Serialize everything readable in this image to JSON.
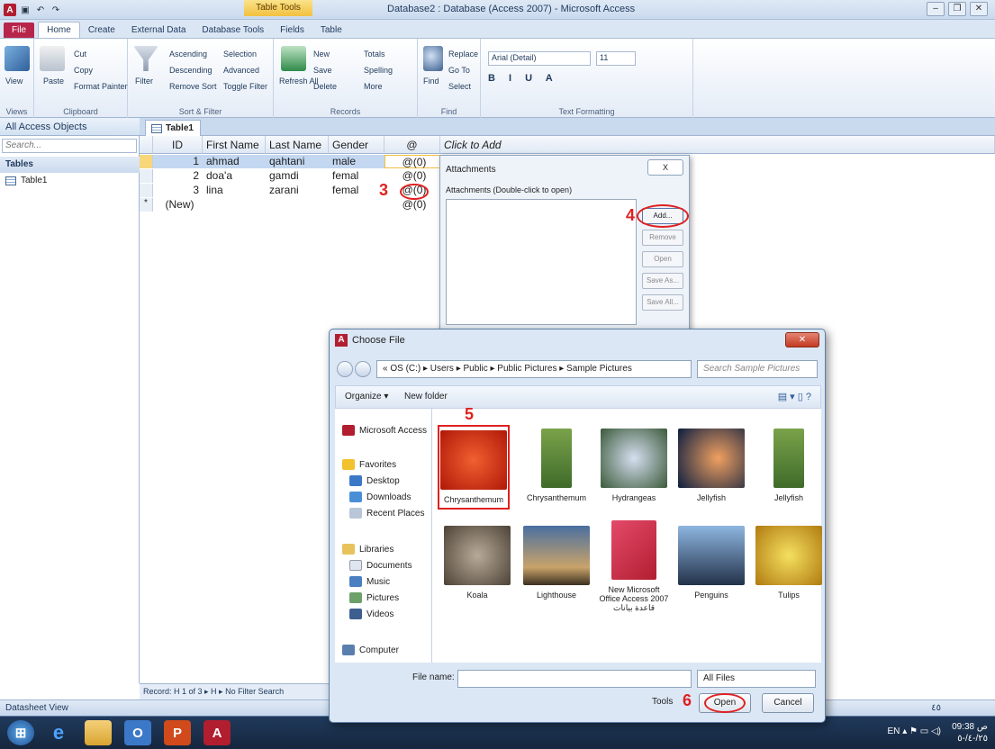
{
  "window": {
    "title": "Database2 : Database (Access 2007) - Microsoft Access",
    "context_tab": "Table Tools",
    "tabs": [
      "File",
      "Home",
      "Create",
      "External Data",
      "Database Tools",
      "Fields",
      "Table"
    ],
    "active_tab": "Home"
  },
  "ribbon": {
    "views": {
      "label": "Views",
      "view": "View"
    },
    "clipboard": {
      "label": "Clipboard",
      "paste": "Paste",
      "cut": "Cut",
      "copy": "Copy",
      "format_painter": "Format Painter"
    },
    "sort_filter": {
      "label": "Sort & Filter",
      "filter": "Filter",
      "ascending": "Ascending",
      "descending": "Descending",
      "remove_sort": "Remove Sort",
      "selection": "Selection",
      "advanced": "Advanced",
      "toggle_filter": "Toggle Filter"
    },
    "records": {
      "label": "Records",
      "refresh": "Refresh All",
      "new": "New",
      "save": "Save",
      "delete": "Delete",
      "totals": "Totals",
      "spelling": "Spelling",
      "more": "More"
    },
    "find": {
      "label": "Find",
      "find": "Find",
      "replace": "Replace",
      "goto": "Go To",
      "select": "Select"
    },
    "text_formatting": {
      "label": "Text Formatting",
      "font": "Arial (Detail)",
      "size": "11"
    }
  },
  "nav_pane": {
    "title": "All Access Objects",
    "search_placeholder": "Search...",
    "section": "Tables",
    "items": [
      "Table1"
    ]
  },
  "document": {
    "tab": "Table1",
    "columns": [
      "ID",
      "First Name",
      "Last Name",
      "Gender",
      "Click to Add"
    ],
    "rows": [
      {
        "id": "1",
        "first": "ahmad",
        "last": "qahtani",
        "gender": "male",
        "att": "(0)"
      },
      {
        "id": "2",
        "first": "doa'a",
        "last": "gamdi",
        "gender": "femal",
        "att": "(0)"
      },
      {
        "id": "3",
        "first": "lina",
        "last": "zarani",
        "gender": "femal",
        "att": "(0)"
      }
    ],
    "new_row": "(New)",
    "new_att": "(0)"
  },
  "record_nav": "Record: H  1 of 3  ▸ H ▸  No Filter  Search",
  "status": "Datasheet View",
  "attachments_dialog": {
    "title": "Attachments",
    "label": "Attachments (Double-click to open)",
    "buttons": [
      "Add...",
      "Remove",
      "Open",
      "Save As...",
      "Save All..."
    ],
    "close": "X"
  },
  "choose_file": {
    "title": "Choose File",
    "path": "« OS (C:)  ▸  Users  ▸  Public  ▸  Public Pictures  ▸  Sample Pictures",
    "search_placeholder": "Search Sample Pictures",
    "organize": "Organize ▾",
    "new_folder": "New folder",
    "sidebar": [
      "Microsoft Access",
      "Favorites",
      "Desktop",
      "Downloads",
      "Recent Places",
      "Libraries",
      "Documents",
      "Music",
      "Pictures",
      "Videos",
      "Computer"
    ],
    "files": [
      {
        "name": "Chrysanthemum",
        "color": "#d9381c"
      },
      {
        "name": "Chrysanthemum",
        "color": "#6b8b3a"
      },
      {
        "name": "Hydrangeas",
        "color": "#8a9ab8"
      },
      {
        "name": "Jellyfish",
        "color": "#3b5c8c"
      },
      {
        "name": "Jellyfish",
        "color": "#6b8b3a"
      },
      {
        "name": "Koala",
        "color": "#8c7f70"
      },
      {
        "name": "Lighthouse",
        "color": "#4a6fa0"
      },
      {
        "name": "New Microsoft Office Access 2007 قاعدة بيانات",
        "color": "#b11e30"
      },
      {
        "name": "Penguins",
        "color": "#5b87b8"
      },
      {
        "name": "Tulips",
        "color": "#d8b020"
      }
    ],
    "file_name_label": "File name:",
    "file_type": "All Files",
    "tools": "Tools",
    "open": "Open",
    "cancel": "Cancel"
  },
  "annotations": [
    "3",
    "4",
    "5",
    "6"
  ],
  "taskbar": {
    "lang": "EN",
    "time": "09:38 ص",
    "date": "٢٥/-٤/-٥",
    "locale_num": "٤٥"
  }
}
